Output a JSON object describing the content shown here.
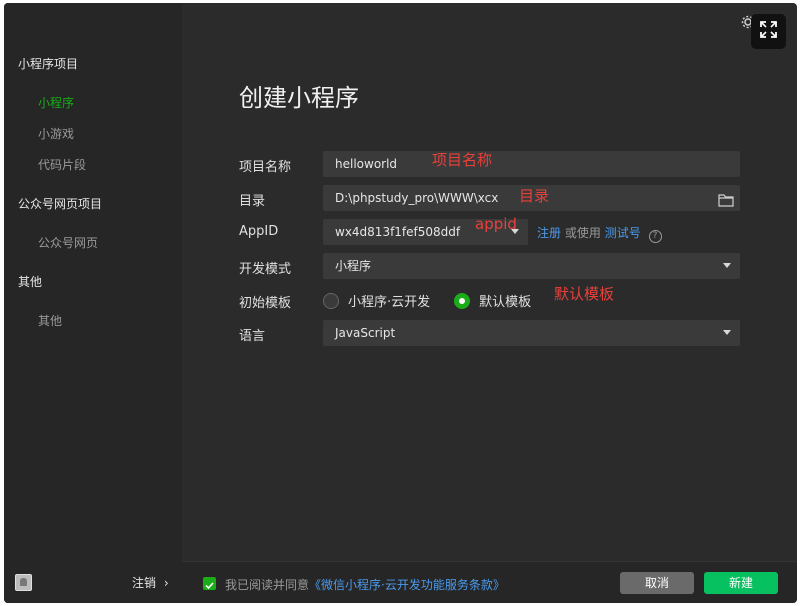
{
  "sidebar": {
    "groups": [
      {
        "label": "小程序项目",
        "items": [
          "小程序",
          "小游戏",
          "代码片段"
        ]
      },
      {
        "label": "公众号网页项目",
        "items": [
          "公众号网页"
        ]
      },
      {
        "label": "其他",
        "items": [
          "其他"
        ]
      }
    ],
    "active_item": "小程序",
    "logout_label": "注销",
    "logout_chevron": "›"
  },
  "page": {
    "title": "创建小程序"
  },
  "form": {
    "project_name": {
      "label": "项目名称",
      "value": "helloworld"
    },
    "directory": {
      "label": "目录",
      "value": "D:\\phpstudy_pro\\WWW\\xcx"
    },
    "appid": {
      "label": "AppID",
      "value": "wx4d813f1fef508ddf",
      "register_link": "注册",
      "or_text": "或使用",
      "test_link": "测试号",
      "help_glyph": "?"
    },
    "dev_mode": {
      "label": "开发模式",
      "value": "小程序"
    },
    "template": {
      "label": "初始模板",
      "option_cloud": "小程序·云开发",
      "option_default": "默认模板",
      "selected": "默认模板"
    },
    "language": {
      "label": "语言",
      "value": "JavaScript"
    }
  },
  "annotations": {
    "project_name": "项目名称",
    "directory": "目录",
    "appid": "appid",
    "template": "默认模板"
  },
  "footer": {
    "agree_prefix": "我已阅读并同意",
    "agree_link": "《微信小程序·云开发功能服务条款》",
    "cancel_label": "取消",
    "create_label": "新建"
  },
  "colors": {
    "accent": "#1aad19",
    "link": "#4a9bef",
    "annotation": "#e8403a",
    "create_button": "#07c160"
  }
}
